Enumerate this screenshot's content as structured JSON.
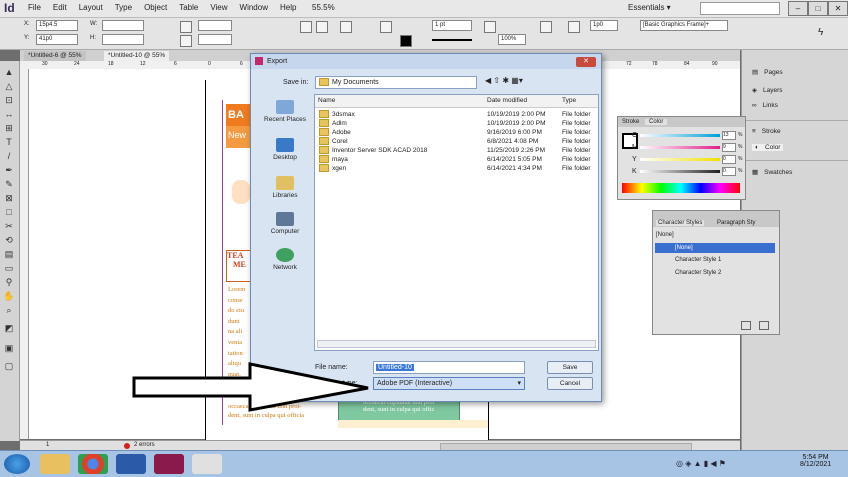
{
  "app": {
    "logo": "Id",
    "menus": [
      "File",
      "Edit",
      "Layout",
      "Type",
      "Object",
      "Table",
      "View",
      "Window",
      "Help"
    ],
    "zoom": "55.5%",
    "workspace": "Essentials ▾"
  },
  "control_panel": {
    "x_label": "X:",
    "x_value": "15p4.5",
    "y_label": "Y:",
    "y_value": "41p0",
    "w_label": "W:",
    "h_label": "H:",
    "stroke_weight": "1 pt",
    "frame_pct": "100%",
    "gutter": "1p0",
    "frame_style": "[Basic Graphics Frame]+"
  },
  "doc_tabs": [
    "*Untitled-6 @ 55%",
    "*Untitled-10 @ 55%"
  ],
  "ruler_ticks": [
    "30",
    "24",
    "18",
    "12",
    "6",
    "0",
    "6",
    "72",
    "78",
    "84",
    "90"
  ],
  "status": {
    "page": "1",
    "errors": "2 errors"
  },
  "export_dialog": {
    "title": "Export",
    "save_in_label": "Save in:",
    "save_in_value": "My Documents",
    "places": [
      "Recent Places",
      "Desktop",
      "Libraries",
      "Computer",
      "Network"
    ],
    "columns": [
      "Name",
      "Date modified",
      "Type"
    ],
    "files": [
      {
        "name": "3dsmax",
        "date": "10/19/2019 2:00 PM",
        "type": "File folder"
      },
      {
        "name": "Adlm",
        "date": "10/19/2019 2:00 PM",
        "type": "File folder"
      },
      {
        "name": "Adobe",
        "date": "9/16/2019 6:00 PM",
        "type": "File folder"
      },
      {
        "name": "Corel",
        "date": "6/8/2021 4:08 PM",
        "type": "File folder"
      },
      {
        "name": "Inventor Server SDK ACAD 2018",
        "date": "11/25/2019 2:26 PM",
        "type": "File folder"
      },
      {
        "name": "maya",
        "date": "6/14/2021 5:05 PM",
        "type": "File folder"
      },
      {
        "name": "xgen",
        "date": "6/14/2021 4:34 PM",
        "type": "File folder"
      }
    ],
    "file_name_label": "File name:",
    "file_name_value": "Untitled-10",
    "save_as_label": "Save as type:",
    "save_as_value": "Adobe PDF (Interactive)",
    "save_button": "Save",
    "cancel_button": "Cancel"
  },
  "dock": {
    "items": [
      "Pages",
      "Layers",
      "Links",
      "Stroke",
      "Color",
      "Swatches"
    ]
  },
  "color_panel": {
    "tabs": [
      "Stroke",
      "Color"
    ],
    "channels": [
      {
        "label": "C",
        "value": "13",
        "unit": "%",
        "color": "#00a0d8"
      },
      {
        "label": "M",
        "value": "9",
        "unit": "%",
        "color": "#e0208a"
      },
      {
        "label": "Y",
        "value": "0",
        "unit": "%",
        "color": "#f0e000"
      },
      {
        "label": "K",
        "value": "0",
        "unit": "%",
        "color": "#222222"
      }
    ]
  },
  "char_styles": {
    "tabs": [
      "Character Styles",
      "Paragraph Sty"
    ],
    "current": "[None]",
    "items": [
      "[None]",
      "Character Style 1",
      "Character Style 2"
    ]
  },
  "page_text": {
    "ba": "BA",
    "new": "New",
    "tea": "TEA",
    "me": "ME",
    "lorem_lines": [
      "Lorem",
      "conse",
      "do eiu",
      "dunt",
      "na ali",
      "venia",
      "tation",
      "aliqu",
      "quat."
    ],
    "bottom_lines": [
      "occaecat cupidatat non proi-",
      "dent, sunt in culpa qui officia"
    ],
    "green_lines": [
      "occaecat cupidatat non proi",
      "dent, sunt in culpa qui offic"
    ]
  },
  "taskbar": {
    "time": "5:54 PM",
    "date": "8/12/2021"
  }
}
